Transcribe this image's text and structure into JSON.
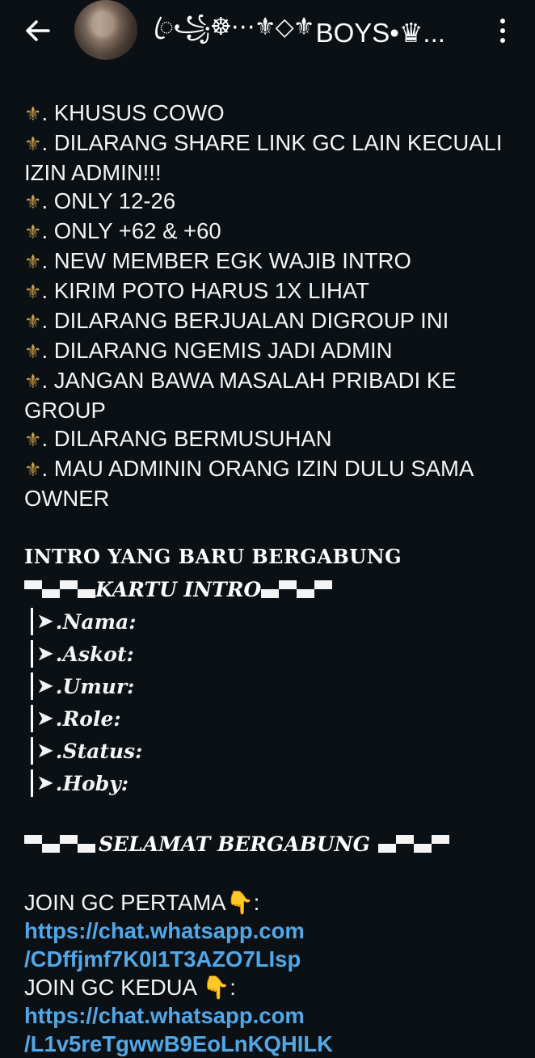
{
  "header": {
    "back_icon": "arrow-left-icon",
    "avatar_icon": "group-avatar",
    "title_deco": "ꦿ꧁☸⋯⚜◇⚜",
    "title_text": "BOYS•♛...",
    "menu_icon": "more-vert-icon"
  },
  "rules": [
    "KHUSUS COWO",
    "DILARANG SHARE LINK GC LAIN KECUALI IZIN ADMIN!!!",
    "ONLY 12-26",
    "ONLY +62 & +60",
    "NEW MEMBER EGK WAJIB INTRO",
    "KIRIM POTO HARUS 1X LIHAT",
    "DILARANG BERJUALAN DIGROUP INI",
    "DILARANG NGEMIS JADI ADMIN",
    "JANGAN BAWA MASALAH PRIBADI KE GROUP",
    "DILARANG BERMUSUHAN",
    "MAU ADMININ ORANG IZIN DULU SAMA OWNER"
  ],
  "rule_bullet": "⚜",
  "intro": {
    "heading": "INTRO YANG BARU BERGABUNG",
    "card_title": "KARTU INTRO",
    "fields": [
      "Nama",
      "Askot",
      "Umur",
      "Role",
      "Status",
      "Hoby"
    ],
    "welcome": "SELAMAT BERGABUNG"
  },
  "join": {
    "first_label": "JOIN GC PERTAMA👇:",
    "first_link_1": "https://chat.whatsapp.com",
    "first_link_2": "/CDffjmf7K0I1T3AZO7LIsp",
    "second_label": "JOIN GC KEDUA 👇:",
    "second_link_1": "https://chat.whatsapp.com",
    "second_link_2": "/L1v5reTgwwB9EoLnKQHILK"
  },
  "colors": {
    "background": "#0b1014",
    "link": "#53a7e6",
    "bullet": "#c9a24c"
  }
}
